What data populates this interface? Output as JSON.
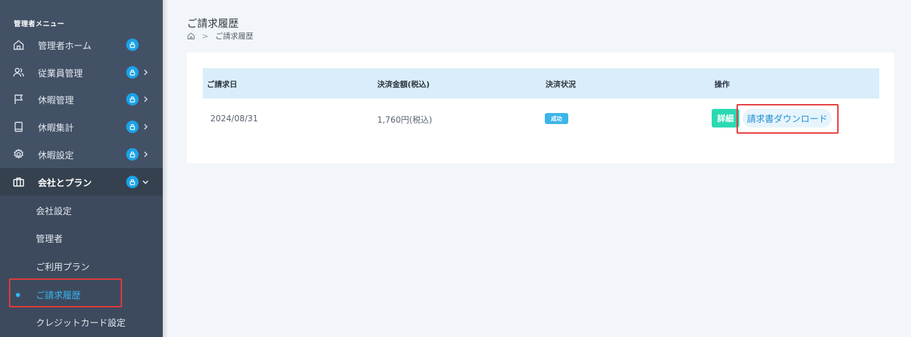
{
  "sidebar": {
    "heading": "管理者メニュー",
    "items": [
      {
        "label": "管理者ホーム",
        "icon": "home-icon"
      },
      {
        "label": "従業員管理",
        "icon": "users-icon"
      },
      {
        "label": "休暇管理",
        "icon": "flag-icon"
      },
      {
        "label": "休暇集計",
        "icon": "book-icon"
      },
      {
        "label": "休暇設定",
        "icon": "gear-icon"
      },
      {
        "label": "会社とプラン",
        "icon": "briefcase-icon"
      }
    ],
    "sub_items": [
      {
        "label": "会社設定"
      },
      {
        "label": "管理者"
      },
      {
        "label": "ご利用プラン"
      },
      {
        "label": "ご請求履歴"
      },
      {
        "label": "クレジットカード設定"
      }
    ]
  },
  "page": {
    "title": "ご請求履歴",
    "breadcrumb_current": "ご請求履歴"
  },
  "table": {
    "headers": {
      "date": "ご請求日",
      "amount": "決済金額(税込)",
      "status": "決済状況",
      "actions": "操作"
    },
    "rows": [
      {
        "date": "2024/08/31",
        "amount": "1,760円(税込)",
        "status": "成功",
        "detail_label": "詳細",
        "download_label": "請求書ダウンロード"
      }
    ]
  },
  "colors": {
    "sidebar_bg": "#435166",
    "accent": "#1aa3e8",
    "success": "#2ad9b2",
    "highlight": "#e53a3a"
  }
}
